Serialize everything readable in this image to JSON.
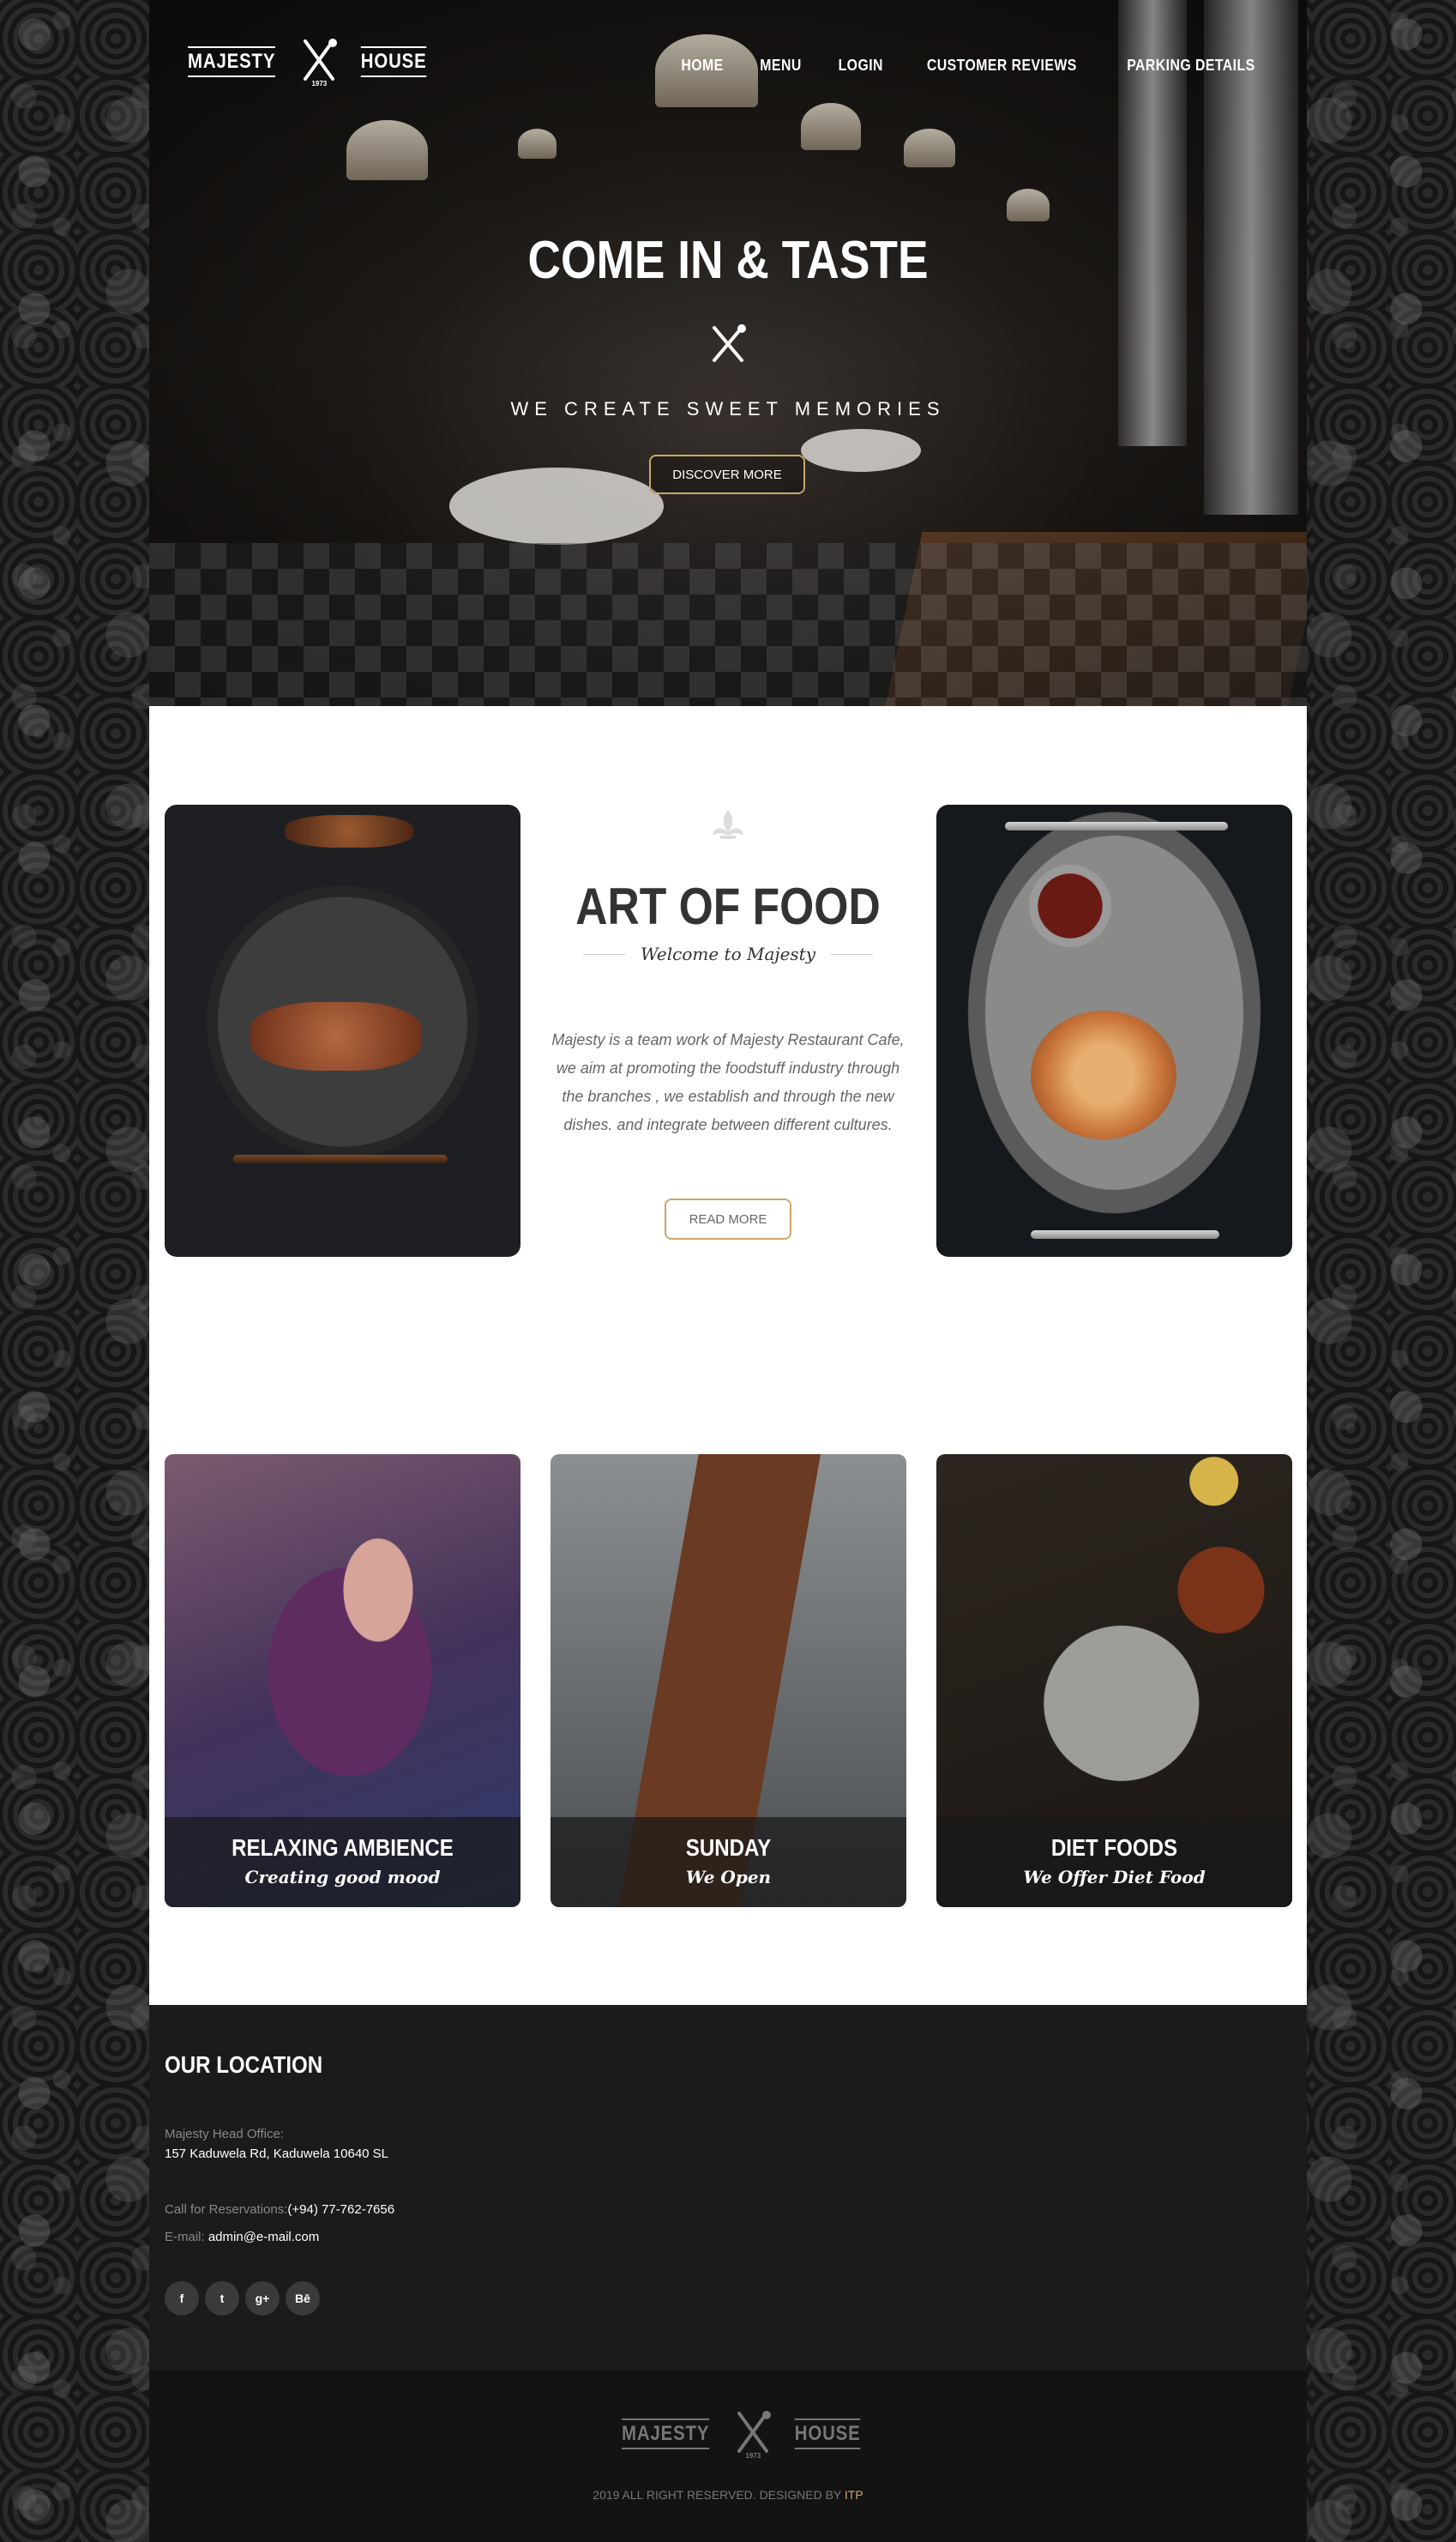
{
  "brand": {
    "left": "MAJESTY",
    "right": "HOUSE",
    "year": "1973"
  },
  "nav": [
    "HOME",
    "MENU",
    "LOGIN",
    "CUSTOMER REVIEWS",
    "PARKING DETAILS"
  ],
  "hero": {
    "title": "COME IN & TASTE",
    "subtitle": "WE CREATE SWEET MEMORIES",
    "button": "DISCOVER MORE"
  },
  "art": {
    "title": "ART OF FOOD",
    "subtitle": "Welcome to Majesty",
    "text": "Majesty is a team work of Majesty Restaurant Cafe, we aim at promoting the foodstuff industry through the branches , we establish and through the new dishes. and integrate between different cultures.",
    "button": "READ MORE"
  },
  "features": [
    {
      "title": "RELAXING AMBIENCE",
      "subtitle": "Creating good mood"
    },
    {
      "title": "SUNDAY",
      "subtitle": "We Open"
    },
    {
      "title": "DIET FOODS",
      "subtitle": "We Offer Diet Food"
    }
  ],
  "location": {
    "title": "OUR LOCATION",
    "office_label": "Majesty Head Office:",
    "office_address": "157 Kaduwela Rd, Kaduwela 10640 SL",
    "call_label": "Call for Reservations:",
    "call_value": "(+94) 77-762-7656",
    "email_label": "E-mail: ",
    "email_value": "admin@e-mail.com",
    "socials": [
      "f",
      "t",
      "g+",
      "Bē"
    ]
  },
  "footer": {
    "copyright": "2019 ALL RIGHT RESERVED. DESIGNED BY ",
    "designer": "ITP"
  },
  "colors": {
    "accent": "#c8a86a",
    "footer_dark": "#1b1b1b",
    "footer_bottom": "#131313"
  },
  "icons": [
    "fork-knife-icon",
    "fleur-de-lis-icon",
    "facebook-icon",
    "twitter-icon",
    "google-plus-icon",
    "behance-icon"
  ]
}
